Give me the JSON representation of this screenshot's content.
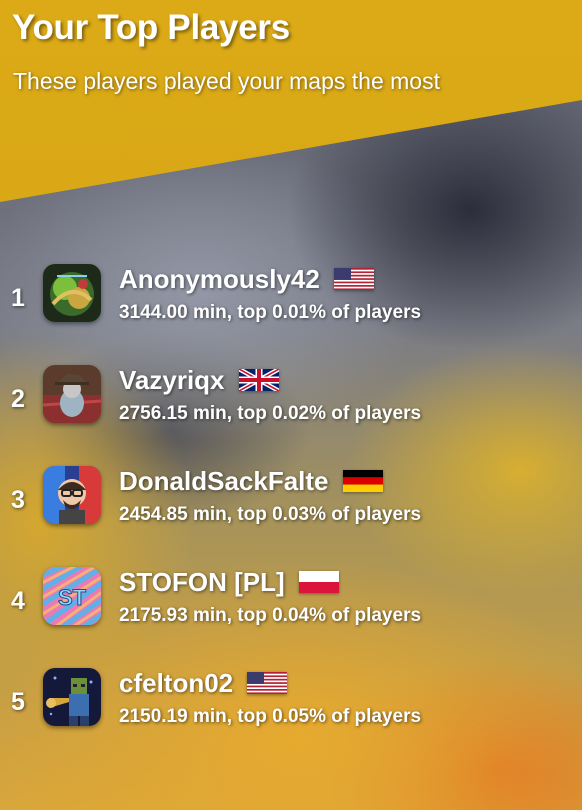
{
  "header": {
    "title": "Your Top Players",
    "subtitle": "These players played your maps the most"
  },
  "players": [
    {
      "rank": "1",
      "name": "Anonymously42",
      "stat": "3144.00 min, top 0.01% of players",
      "flag": "us-flag-icon",
      "avatar": "avatar-green-logo"
    },
    {
      "rank": "2",
      "name": "Vazyriqx",
      "stat": "2756.15 min, top 0.02% of players",
      "flag": "uk-flag-icon",
      "avatar": "avatar-cat-hat"
    },
    {
      "rank": "3",
      "name": "DonaldSackFalte",
      "stat": "2454.85 min, top 0.03% of players",
      "flag": "germany-flag-icon",
      "avatar": "avatar-cartoon-man"
    },
    {
      "rank": "4",
      "name": "STOFON [PL]",
      "stat": "2175.93 min, top 0.04% of players",
      "flag": "poland-flag-icon",
      "avatar": "avatar-st-logo"
    },
    {
      "rank": "5",
      "name": "cfelton02",
      "stat": "2150.19 min, top 0.05% of players",
      "flag": "us-flag-icon",
      "avatar": "avatar-blocky-trumpet"
    }
  ],
  "colors": {
    "header_band": "#dcaa16",
    "text": "#ffffff"
  }
}
